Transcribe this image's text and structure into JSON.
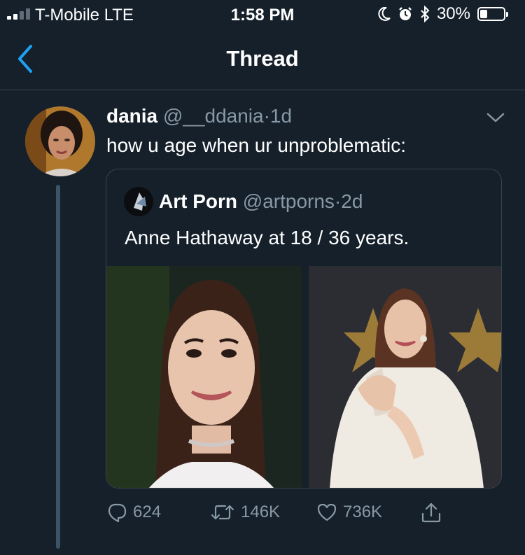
{
  "status_bar": {
    "carrier": "T-Mobile  LTE",
    "time": "1:58 PM",
    "battery_percent": "30%",
    "battery_level": 0.3,
    "signal_bars": 2
  },
  "nav": {
    "title": "Thread",
    "back_icon": "chevron-left-icon",
    "accent_color": "#1da1f2"
  },
  "tweet": {
    "author_name": "dania",
    "author_handle": "@__ddania",
    "separator": "·",
    "time": "1d",
    "text": "how u age when ur unproblematic:",
    "quoted": {
      "author_name": "Art Porn",
      "author_handle": "@artporns",
      "separator": "·",
      "time": "2d",
      "text": "Anne Hathaway at 18 / 36 years."
    },
    "actions": {
      "replies": "624",
      "retweets": "146K",
      "likes": "736K"
    }
  },
  "theme": {
    "background": "#15202b",
    "border": "#38444d",
    "secondary_text": "#8899a6",
    "thread_line": "#3d5466"
  }
}
